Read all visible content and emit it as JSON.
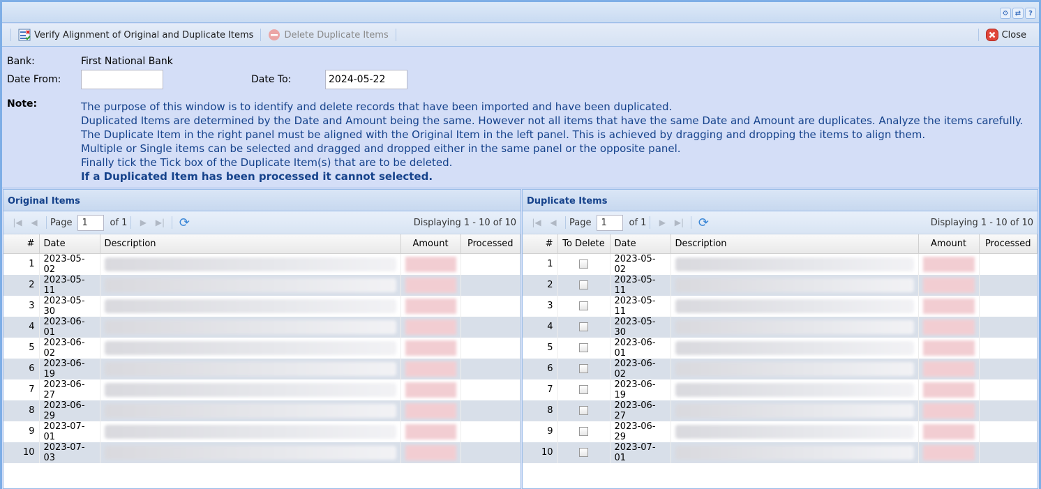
{
  "header": {
    "tools": [
      "gear-icon",
      "refresh-icon",
      "help-icon"
    ]
  },
  "toolbar": {
    "verify_label": "Verify Alignment of Original and Duplicate Items",
    "delete_label": "Delete Duplicate Items",
    "close_label": "Close"
  },
  "form": {
    "bank_label": "Bank:",
    "bank_value": "First National Bank",
    "date_from_label": "Date From:",
    "date_from_value": "",
    "date_to_label": "Date To:",
    "date_to_value": "2024-05-22",
    "note_label": "Note:",
    "note_lines": [
      "The purpose of this window is to identify and delete records that have been imported and have been duplicated.",
      "Duplicated Items are determined by the Date and Amount being the same. However not all items that have the same Date and Amount are duplicates. Analyze the items carefully.",
      "The Duplicate Item in the right panel must be aligned with the Original Item in the left panel. This is achieved by dragging and dropping the items to align them.",
      "Multiple or Single items can be selected and dragged and dropped either in the same panel or the opposite panel.",
      "Finally tick the Tick box of the Duplicate Item(s) that are to be deleted."
    ],
    "note_bold": "If a Duplicated Item has been processed it cannot selected."
  },
  "original": {
    "title": "Original Items",
    "page_label": "Page",
    "page": "1",
    "of_label": "of 1",
    "displaying": "Displaying 1 - 10 of 10",
    "columns": [
      "#",
      "Date",
      "Description",
      "Amount",
      "Processed"
    ],
    "rows": [
      [
        "1",
        "2023-05-02"
      ],
      [
        "2",
        "2023-05-11"
      ],
      [
        "3",
        "2023-05-30"
      ],
      [
        "4",
        "2023-06-01"
      ],
      [
        "5",
        "2023-06-02"
      ],
      [
        "6",
        "2023-06-19"
      ],
      [
        "7",
        "2023-06-27"
      ],
      [
        "8",
        "2023-06-29"
      ],
      [
        "9",
        "2023-07-01"
      ],
      [
        "10",
        "2023-07-03"
      ]
    ]
  },
  "duplicate": {
    "title": "Duplicate Items",
    "page_label": "Page",
    "page": "1",
    "of_label": "of 1",
    "displaying": "Displaying 1 - 10 of 10",
    "columns": [
      "#",
      "To Delete",
      "Date",
      "Description",
      "Amount",
      "Processed"
    ],
    "rows": [
      [
        "1",
        "2023-05-02"
      ],
      [
        "2",
        "2023-05-11"
      ],
      [
        "3",
        "2023-05-11"
      ],
      [
        "4",
        "2023-05-30"
      ],
      [
        "5",
        "2023-06-01"
      ],
      [
        "6",
        "2023-06-02"
      ],
      [
        "7",
        "2023-06-19"
      ],
      [
        "8",
        "2023-06-27"
      ],
      [
        "9",
        "2023-06-29"
      ],
      [
        "10",
        "2023-07-01"
      ]
    ]
  }
}
